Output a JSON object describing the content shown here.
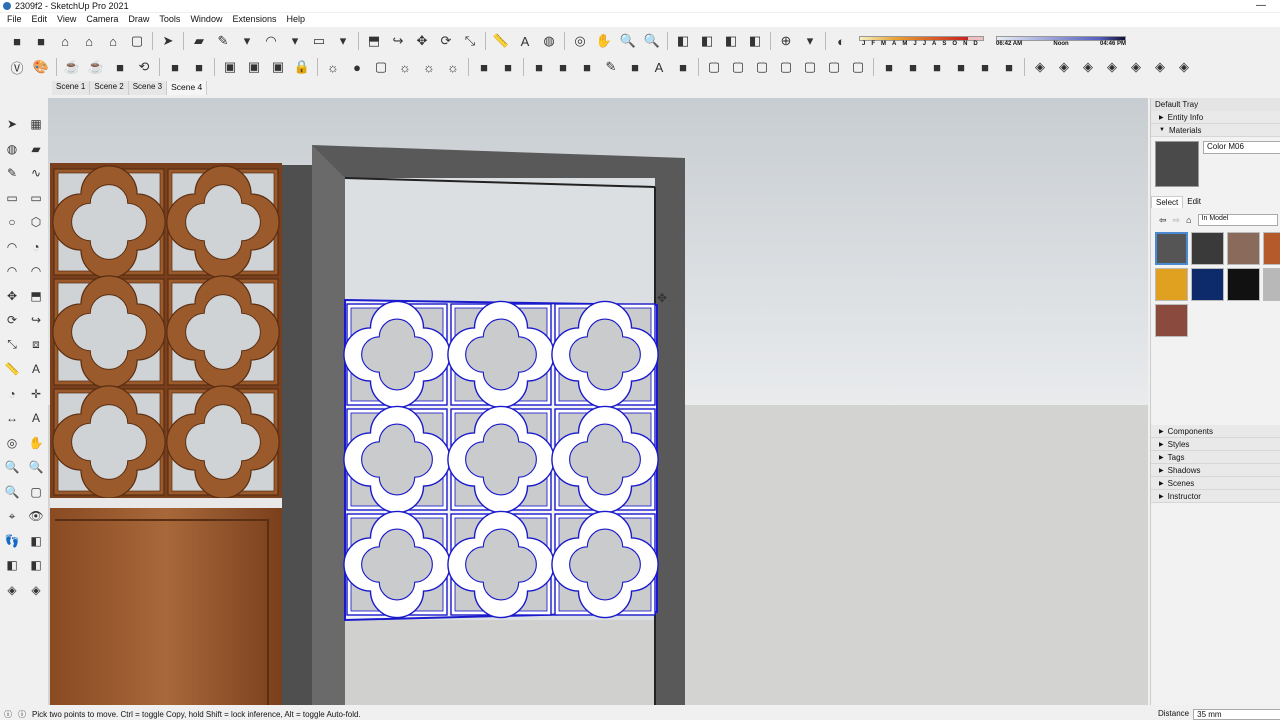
{
  "window": {
    "title": "2309f2 - SketchUp Pro 2021"
  },
  "menu": [
    "File",
    "Edit",
    "View",
    "Camera",
    "Draw",
    "Tools",
    "Window",
    "Extensions",
    "Help"
  ],
  "toolbar1": [
    "warehouse-icon",
    "extension-icon",
    "home-icon",
    "house-icon",
    "outline-house-icon",
    "box-icon",
    "|",
    "select-arrow-icon",
    "|",
    "eraser-icon",
    "pencil-icon",
    "chevron-down-icon",
    "arc-icon",
    "chevron-down-icon",
    "rectangle-icon",
    "chevron-down-icon",
    "|",
    "push-pull-icon",
    "follow-me-icon",
    "move-icon",
    "rotate-icon",
    "scale-icon",
    "|",
    "tape-measure-icon",
    "text-icon",
    "paint-bucket-icon",
    "|",
    "orbit-icon",
    "pan-icon",
    "zoom-icon",
    "zoom-extents-icon",
    "|",
    "section-plane-icon",
    "section-fill-icon",
    "display-section-icon",
    "section-cut-icon",
    "|",
    "geo-location-icon",
    "chevron-down-icon",
    "|",
    "shadow-toggle-icon"
  ],
  "toolbar2": [
    "v-ray-icon",
    "palette-icon",
    "|",
    "teapot-icon",
    "teapot-interactive-icon",
    "denoise-icon",
    "refresh-icon",
    "|",
    "frame-buffer-icon",
    "material-editor-icon",
    "|",
    "window-icon",
    "window-render-icon",
    "window-region-icon",
    "lock-icon",
    "|",
    "light-plane-icon",
    "sphere-light-icon",
    "box-light-icon",
    "mesh-light-icon",
    "ies-light-icon",
    "dome-light-icon",
    "|",
    "proxy-icon",
    "fur-icon",
    "|",
    "xray-icon",
    "back-edges-icon",
    "wireframe-icon",
    "hidden-line-icon",
    "shaded-icon",
    "textured-icon",
    "monochrome-icon",
    "|",
    "iso-view-icon",
    "top-view-icon",
    "front-view-icon",
    "right-view-icon",
    "back-view-icon",
    "left-view-icon",
    "bottom-view-icon",
    "|",
    "terrain-icon",
    "stamp-icon",
    "smoove-icon",
    "add-detail-icon",
    "flip-edge-icon",
    "drape-icon",
    "|",
    "sandbox-a-icon",
    "sandbox-b-icon",
    "sandbox-c-icon",
    "sandbox-d-icon",
    "sandbox-e-icon",
    "sandbox-f-icon",
    "sandbox-g-icon"
  ],
  "shadow": {
    "months": [
      "J",
      "F",
      "M",
      "A",
      "M",
      "J",
      "J",
      "A",
      "S",
      "O",
      "N",
      "D"
    ],
    "time_start": "06:42 AM",
    "time_mid": "Noon",
    "time_end": "04:46 PM",
    "date_fraction": 0.88,
    "time_fraction": 0.8
  },
  "scenes": [
    "Scene 1",
    "Scene 2",
    "Scene 3",
    "Scene 4"
  ],
  "lefttools": [
    "select-icon",
    "component-icon",
    "paint-icon",
    "eraser-icon",
    "line-icon",
    "freehand-icon",
    "rectangle-icon",
    "rotated-rect-icon",
    "circle-icon",
    "polygon-icon",
    "arc-icon",
    "pie-icon",
    "arc3-icon",
    "arc2-icon",
    "move-icon",
    "push-pull-icon",
    "rotate-icon",
    "follow-me-icon",
    "scale-icon",
    "offset-icon",
    "tape-icon",
    "text-icon",
    "protractor-icon",
    "axes-icon",
    "dimension-icon",
    "3d-text-icon",
    "orbit-icon",
    "pan-icon",
    "zoom-icon",
    "zoom-window-icon",
    "zoom-extents-icon",
    "previous-view-icon",
    "position-camera-icon",
    "look-around-icon",
    "walk-icon",
    "section-plane-icon",
    "display-section-icon",
    "section-cut-icon",
    "sandbox-icon",
    "sandbox-drape-icon"
  ],
  "tray": {
    "title": "Default Tray",
    "entity_info": "Entity Info",
    "materials": "Materials",
    "material_name": "Color M06",
    "tab_select": "Select",
    "tab_edit": "Edit",
    "collection": "In Model",
    "swatch_colors": [
      "#555555",
      "#3a3a3a",
      "#8a6a5a",
      "#b55a2a",
      "#e0a020",
      "#0d2a6a",
      "#111111",
      "#b8b8b8",
      "#8a4a3e"
    ],
    "sections": [
      "Components",
      "Styles",
      "Tags",
      "Shadows",
      "Scenes",
      "Instructor"
    ]
  },
  "status": {
    "message": "Pick two points to move.  Ctrl = toggle Copy, hold Shift = lock inference, Alt = toggle Auto-fold.",
    "distance_label": "Distance",
    "distance_value": "35 mm"
  },
  "colors": {
    "selection": "#1a1acc",
    "wood": "#8a4a25",
    "frame": "#5a5a5a"
  }
}
